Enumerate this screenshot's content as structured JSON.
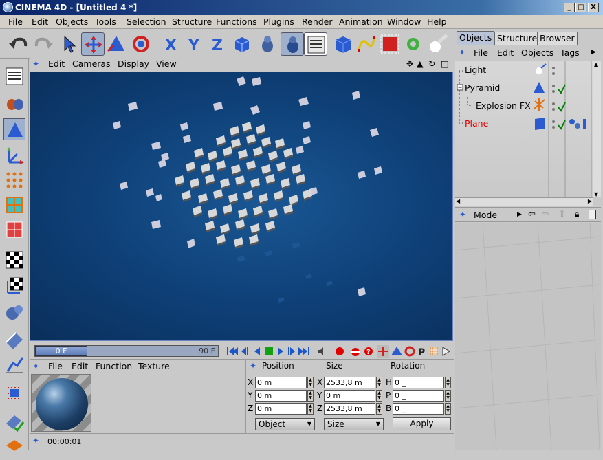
{
  "window": {
    "title": "CINEMA 4D - [Untitled 4 *]",
    "buttons": {
      "min": "_",
      "max": "□",
      "close": "X"
    }
  },
  "menubar": [
    "File",
    "Edit",
    "Objects",
    "Tools",
    "Selection",
    "Structure",
    "Functions",
    "Plugins",
    "Render",
    "Animation",
    "Window",
    "Help"
  ],
  "viewport": {
    "menu": [
      "Edit",
      "Cameras",
      "Display",
      "View"
    ]
  },
  "timeline": {
    "current_frame": "0 F",
    "end_frame": "90 F"
  },
  "material_manager": {
    "menu": [
      "File",
      "Edit",
      "Function",
      "Texture"
    ]
  },
  "coordinates": {
    "headers": {
      "position": "Position",
      "size": "Size",
      "rotation": "Rotation"
    },
    "axes": [
      "X",
      "Y",
      "Z"
    ],
    "rot_axes": [
      "H",
      "P",
      "B"
    ],
    "position": [
      "0 m",
      "0 m",
      "0 m"
    ],
    "size": [
      "2533,8 m",
      "0 m",
      "2533,8 m"
    ],
    "rotation": [
      "0 _",
      "0 _",
      "0 _"
    ],
    "mode_object": "Object",
    "mode_size": "Size",
    "apply": "Apply"
  },
  "status": {
    "time": "00:00:01"
  },
  "object_manager": {
    "tabs": [
      "Objects",
      "Structure",
      "Browser"
    ],
    "menu": [
      "File",
      "Edit",
      "Objects",
      "Tags"
    ],
    "objects": [
      {
        "name": "Light"
      },
      {
        "name": "Pyramid"
      },
      {
        "name": "Explosion FX"
      },
      {
        "name": "Plane"
      }
    ]
  },
  "attribute_manager": {
    "mode": "Mode"
  },
  "colors": {
    "title_bar": "#0a246a",
    "viewport": "#0e3f76",
    "selected_object": "#e00000",
    "check": "#008000"
  }
}
